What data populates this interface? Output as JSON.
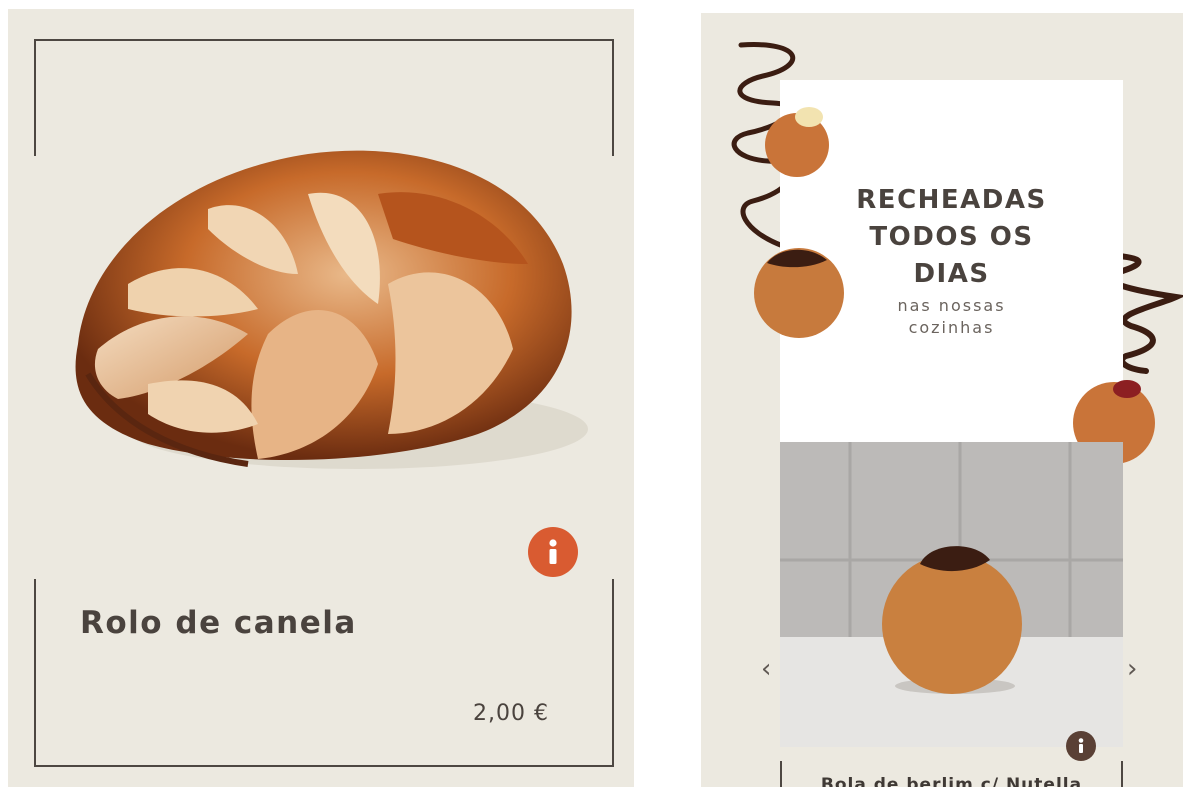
{
  "left_card": {
    "product_name": "Rolo de canela",
    "price": "2,00 €",
    "info_label": "i",
    "image_icon": "cinnamon-roll-image"
  },
  "right_card": {
    "headline": [
      "RECHEADAS",
      "TODOS OS",
      "DIAS"
    ],
    "subheadline": [
      "nas nossas",
      "cozinhas"
    ],
    "prev_arrow": "‹",
    "next_arrow": "›",
    "info_label": "i",
    "next_product_name": "Bola de berlim c/ Nutella",
    "image_icon": "berliner-nutella-image"
  },
  "colors": {
    "background": "#ece9e0",
    "text": "#4a433e",
    "info_orange": "#d95b31",
    "info_brown": "#5a4035",
    "chocolate": "#3b1d12"
  }
}
